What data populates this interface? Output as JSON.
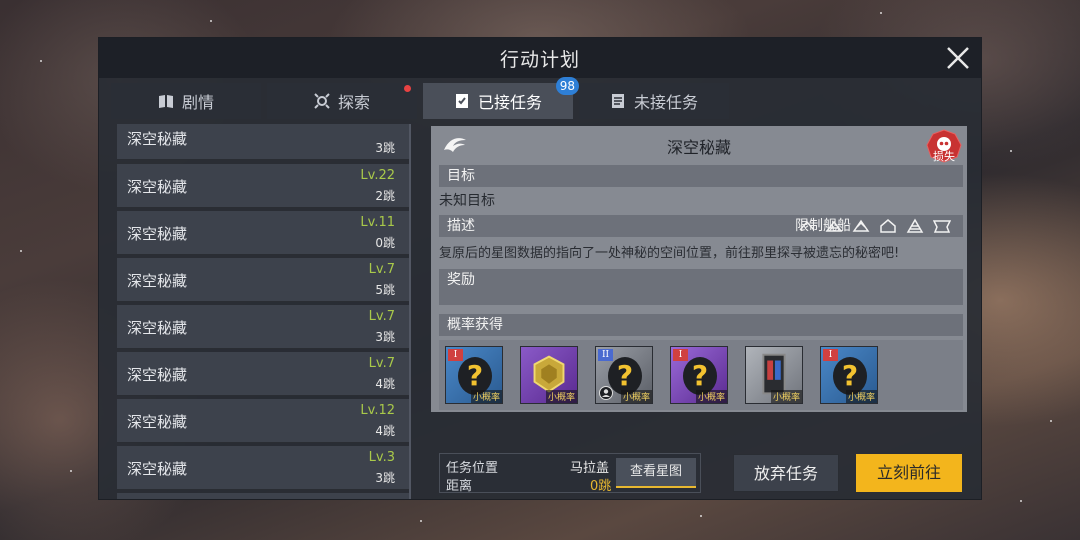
{
  "window": {
    "title": "行动计划"
  },
  "tabs": [
    {
      "label": "剧情",
      "icon": "book-icon"
    },
    {
      "label": "探索",
      "icon": "radar-icon",
      "dot": true
    },
    {
      "label": "已接任务",
      "icon": "checklist-icon",
      "badge": "98",
      "active": true
    },
    {
      "label": "未接任务",
      "icon": "document-icon"
    }
  ],
  "missions": [
    {
      "name": "深空秘藏",
      "level": "",
      "jumps": "3跳"
    },
    {
      "name": "深空秘藏",
      "level": "Lv.22",
      "jumps": "2跳"
    },
    {
      "name": "深空秘藏",
      "level": "Lv.11",
      "jumps": "0跳"
    },
    {
      "name": "深空秘藏",
      "level": "Lv.7",
      "jumps": "5跳"
    },
    {
      "name": "深空秘藏",
      "level": "Lv.7",
      "jumps": "3跳"
    },
    {
      "name": "深空秘藏",
      "level": "Lv.7",
      "jumps": "4跳"
    },
    {
      "name": "深空秘藏",
      "level": "Lv.12",
      "jumps": "4跳"
    },
    {
      "name": "深空秘藏",
      "level": "Lv.3",
      "jumps": "3跳"
    },
    {
      "name": "",
      "level": "",
      "jumps": ""
    }
  ],
  "detail": {
    "title": "深空秘藏",
    "lost_label": "损失",
    "target_header": "目标",
    "target_text": "未知目标",
    "desc_header": "描述",
    "ship_limit_label": "限制舰船",
    "desc_text": "复原后的星图数据的指向了一处神秘的空间位置，前往那里探寻被遗忘的秘密吧!",
    "reward_header": "奖励",
    "chance_header": "概率获得",
    "items": [
      {
        "tier": "I",
        "chance": "小概率",
        "kind": "unknown"
      },
      {
        "tier": "",
        "chance": "小概率",
        "kind": "gold-crystal"
      },
      {
        "tier": "II",
        "chance": "小概率",
        "kind": "unknown-module"
      },
      {
        "tier": "I",
        "chance": "小概率",
        "kind": "unknown-purple"
      },
      {
        "tier": "",
        "chance": "小概率",
        "kind": "device"
      },
      {
        "tier": "I",
        "chance": "小概率",
        "kind": "unknown"
      }
    ]
  },
  "location": {
    "label": "任务位置",
    "value": "马拉盖",
    "distance_label": "距离",
    "distance_value": "0跳",
    "map_button": "查看星图"
  },
  "actions": {
    "abandon": "放弃任务",
    "go": "立刻前往"
  },
  "colors": {
    "accent": "#f3b51c",
    "level_green": "#a9c94a",
    "badge_blue": "#2e7fd6",
    "lost_red": "#d03a3a"
  }
}
